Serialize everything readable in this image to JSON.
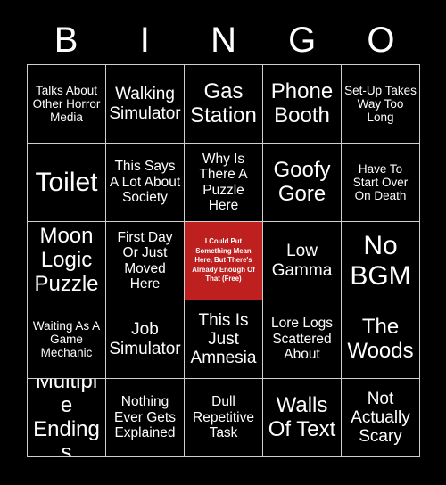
{
  "card": {
    "title_letters": [
      "B",
      "I",
      "N",
      "G",
      "O"
    ],
    "background_color": "#000000",
    "text_color": "#ffffff",
    "grid_line_color": "#cfcfcf",
    "free_space_color": "#be2020",
    "grid_size": "5x5"
  },
  "cells": [
    {
      "text": "Talks About Other Horror Media",
      "size": "sm",
      "free": false
    },
    {
      "text": "Walking Simulator",
      "size": "lg",
      "free": false
    },
    {
      "text": "Gas Station",
      "size": "xl",
      "free": false
    },
    {
      "text": "Phone Booth",
      "size": "xl",
      "free": false
    },
    {
      "text": "Set-Up Takes Way Too Long",
      "size": "sm",
      "free": false
    },
    {
      "text": "Toilet",
      "size": "xxl",
      "free": false
    },
    {
      "text": "This Says A Lot About Society",
      "size": "md",
      "free": false
    },
    {
      "text": "Why Is There A Puzzle Here",
      "size": "md",
      "free": false
    },
    {
      "text": "Goofy Gore",
      "size": "xl",
      "free": false
    },
    {
      "text": "Have To Start Over On Death",
      "size": "sm",
      "free": false
    },
    {
      "text": "Moon Logic Puzzle",
      "size": "xl",
      "free": false
    },
    {
      "text": "First Day Or Just Moved Here",
      "size": "md",
      "free": false
    },
    {
      "text": "I Could Put Something Mean Here, But There's Already Enough Of That (Free)",
      "size": "tiny",
      "free": true
    },
    {
      "text": "Low Gamma",
      "size": "lg",
      "free": false
    },
    {
      "text": "No BGM",
      "size": "xxl",
      "free": false
    },
    {
      "text": "Waiting As A Game Mechanic",
      "size": "sm",
      "free": false
    },
    {
      "text": "Job Simulator",
      "size": "lg",
      "free": false
    },
    {
      "text": "This Is Just Amnesia",
      "size": "lg",
      "free": false
    },
    {
      "text": "Lore Logs Scattered About",
      "size": "md",
      "free": false
    },
    {
      "text": "The Woods",
      "size": "xl",
      "free": false
    },
    {
      "text": "Multiple Endings",
      "size": "xl",
      "free": false
    },
    {
      "text": "Nothing Ever Gets Explained",
      "size": "md",
      "free": false
    },
    {
      "text": "Dull Repetitive Task",
      "size": "md",
      "free": false
    },
    {
      "text": "Walls Of Text",
      "size": "xl",
      "free": false
    },
    {
      "text": "Not Actually Scary",
      "size": "lg",
      "free": false
    }
  ]
}
